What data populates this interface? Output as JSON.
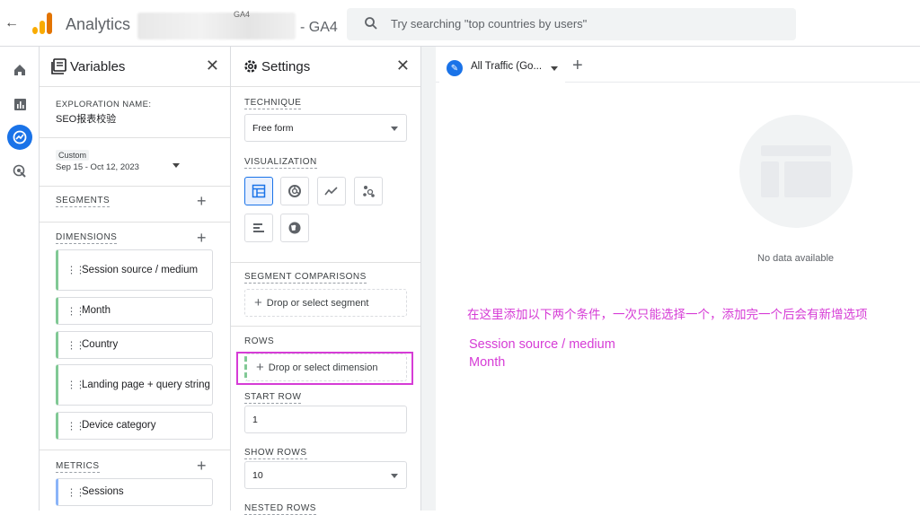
{
  "header": {
    "back_icon": "arrow-left-icon",
    "app_name": "Analytics",
    "property_tiny": "GA4",
    "property_name": "- GA4",
    "search_placeholder": "Try searching \"top countries by users\""
  },
  "left_nav": {
    "items": [
      "home-icon",
      "reports-icon",
      "explore-icon",
      "advertising-icon"
    ],
    "active": "explore-icon"
  },
  "variables_panel": {
    "title": "Variables",
    "exploration_label": "EXPLORATION NAME:",
    "exploration_name": "SEO报表校验",
    "date_tag": "Custom",
    "date_range": "Sep 15 - Oct 12, 2023",
    "segments_label": "SEGMENTS",
    "dimensions_label": "DIMENSIONS",
    "dimensions": [
      "Session source / medium",
      "Month",
      "Country",
      "Landing page + query string",
      "Device category"
    ],
    "metrics_label": "METRICS",
    "metrics": [
      "Sessions"
    ]
  },
  "settings_panel": {
    "title": "Settings",
    "technique_label": "TECHNIQUE",
    "technique_value": "Free form",
    "visualization_label": "VISUALIZATION",
    "visualizations": [
      "table-icon",
      "donut-chart-icon",
      "line-chart-icon",
      "scatter-plot-icon",
      "bar-chart-icon",
      "globe-icon"
    ],
    "segment_comparisons_label": "SEGMENT COMPARISONS",
    "segment_drop": "Drop or select segment",
    "rows_label": "ROWS",
    "rows_drop": "Drop or select dimension",
    "start_row_label": "START ROW",
    "start_row_value": "1",
    "show_rows_label": "SHOW ROWS",
    "show_rows_value": "10",
    "nested_rows_label": "NESTED ROWS"
  },
  "canvas": {
    "tab_label": "All Traffic (Go...",
    "no_data": "No data available",
    "annotation_cn": "在这里添加以下两个条件，一次只能选择一个，添加完一个后会有新增选项",
    "annotation_lines": [
      "Session source / medium",
      "Month"
    ]
  },
  "colors": {
    "accent": "#1a73e8",
    "annotation": "#d63cd6",
    "dimension_bar": "#81c995",
    "metric_bar": "#8ab4f8"
  }
}
